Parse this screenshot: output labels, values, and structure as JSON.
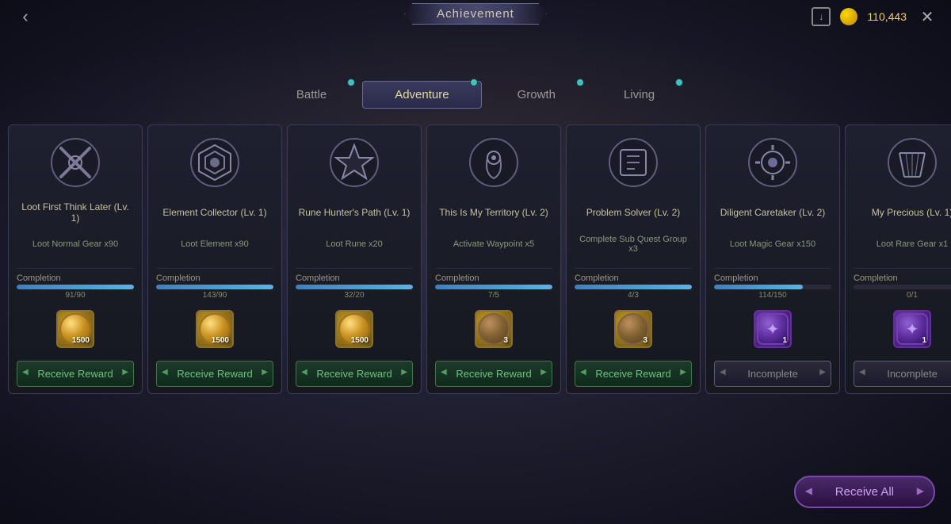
{
  "header": {
    "title": "Achievement",
    "currency_amount": "110,443",
    "back_label": "‹",
    "close_label": "✕"
  },
  "tabs": [
    {
      "id": "battle",
      "label": "Battle",
      "active": false,
      "dot": true
    },
    {
      "id": "adventure",
      "label": "Adventure",
      "active": true,
      "dot": true
    },
    {
      "id": "growth",
      "label": "Growth",
      "active": false,
      "dot": true
    },
    {
      "id": "living",
      "label": "Living",
      "active": false,
      "dot": true
    }
  ],
  "cards": [
    {
      "title": "Loot First Think Later (Lv. 1)",
      "task": "Loot Normal Gear x90",
      "completion_label": "Completion",
      "progress_current": 91,
      "progress_max": 90,
      "progress_text": "91/90",
      "progress_pct": 100,
      "reward_type": "gold",
      "reward_count": "1500",
      "btn_type": "receive",
      "btn_label": "Receive Reward"
    },
    {
      "title": "Element Collector (Lv. 1)",
      "task": "Loot Element x90",
      "completion_label": "Completion",
      "progress_current": 143,
      "progress_max": 90,
      "progress_text": "143/90",
      "progress_pct": 100,
      "reward_type": "gold",
      "reward_count": "1500",
      "btn_type": "receive",
      "btn_label": "Receive Reward"
    },
    {
      "title": "Rune Hunter's Path (Lv. 1)",
      "task": "Loot Rune x20",
      "completion_label": "Completion",
      "progress_current": 32,
      "progress_max": 20,
      "progress_text": "32/20",
      "progress_pct": 100,
      "reward_type": "gold",
      "reward_count": "1500",
      "btn_type": "receive",
      "btn_label": "Receive Reward"
    },
    {
      "title": "This Is My Territory (Lv. 2)",
      "task": "Activate Waypoint x5",
      "completion_label": "Completion",
      "progress_current": 7,
      "progress_max": 5,
      "progress_text": "7/5",
      "progress_pct": 100,
      "reward_type": "brown",
      "reward_count": "3",
      "btn_type": "receive",
      "btn_label": "Receive Reward"
    },
    {
      "title": "Problem Solver (Lv. 2)",
      "task": "Complete Sub Quest Group x3",
      "completion_label": "Completion",
      "progress_current": 4,
      "progress_max": 3,
      "progress_text": "4/3",
      "progress_pct": 100,
      "reward_type": "brown",
      "reward_count": "3",
      "btn_type": "receive",
      "btn_label": "Receive Reward"
    },
    {
      "title": "Diligent Caretaker (Lv. 2)",
      "task": "Loot Magic Gear x150",
      "completion_label": "Completion",
      "progress_current": 114,
      "progress_max": 150,
      "progress_text": "114/150",
      "progress_pct": 76,
      "reward_type": "purple",
      "reward_count": "1",
      "btn_type": "incomplete",
      "btn_label": "Incomplete"
    },
    {
      "title": "My Precious (Lv. 1)",
      "task": "Loot Rare Gear x1",
      "completion_label": "Completion",
      "progress_current": 0,
      "progress_max": 1,
      "progress_text": "0/1",
      "progress_pct": 0,
      "reward_type": "purple",
      "reward_count": "1",
      "btn_type": "incomplete",
      "btn_label": "Incomplete"
    }
  ],
  "bottom": {
    "receive_all_label": "Receive All"
  }
}
